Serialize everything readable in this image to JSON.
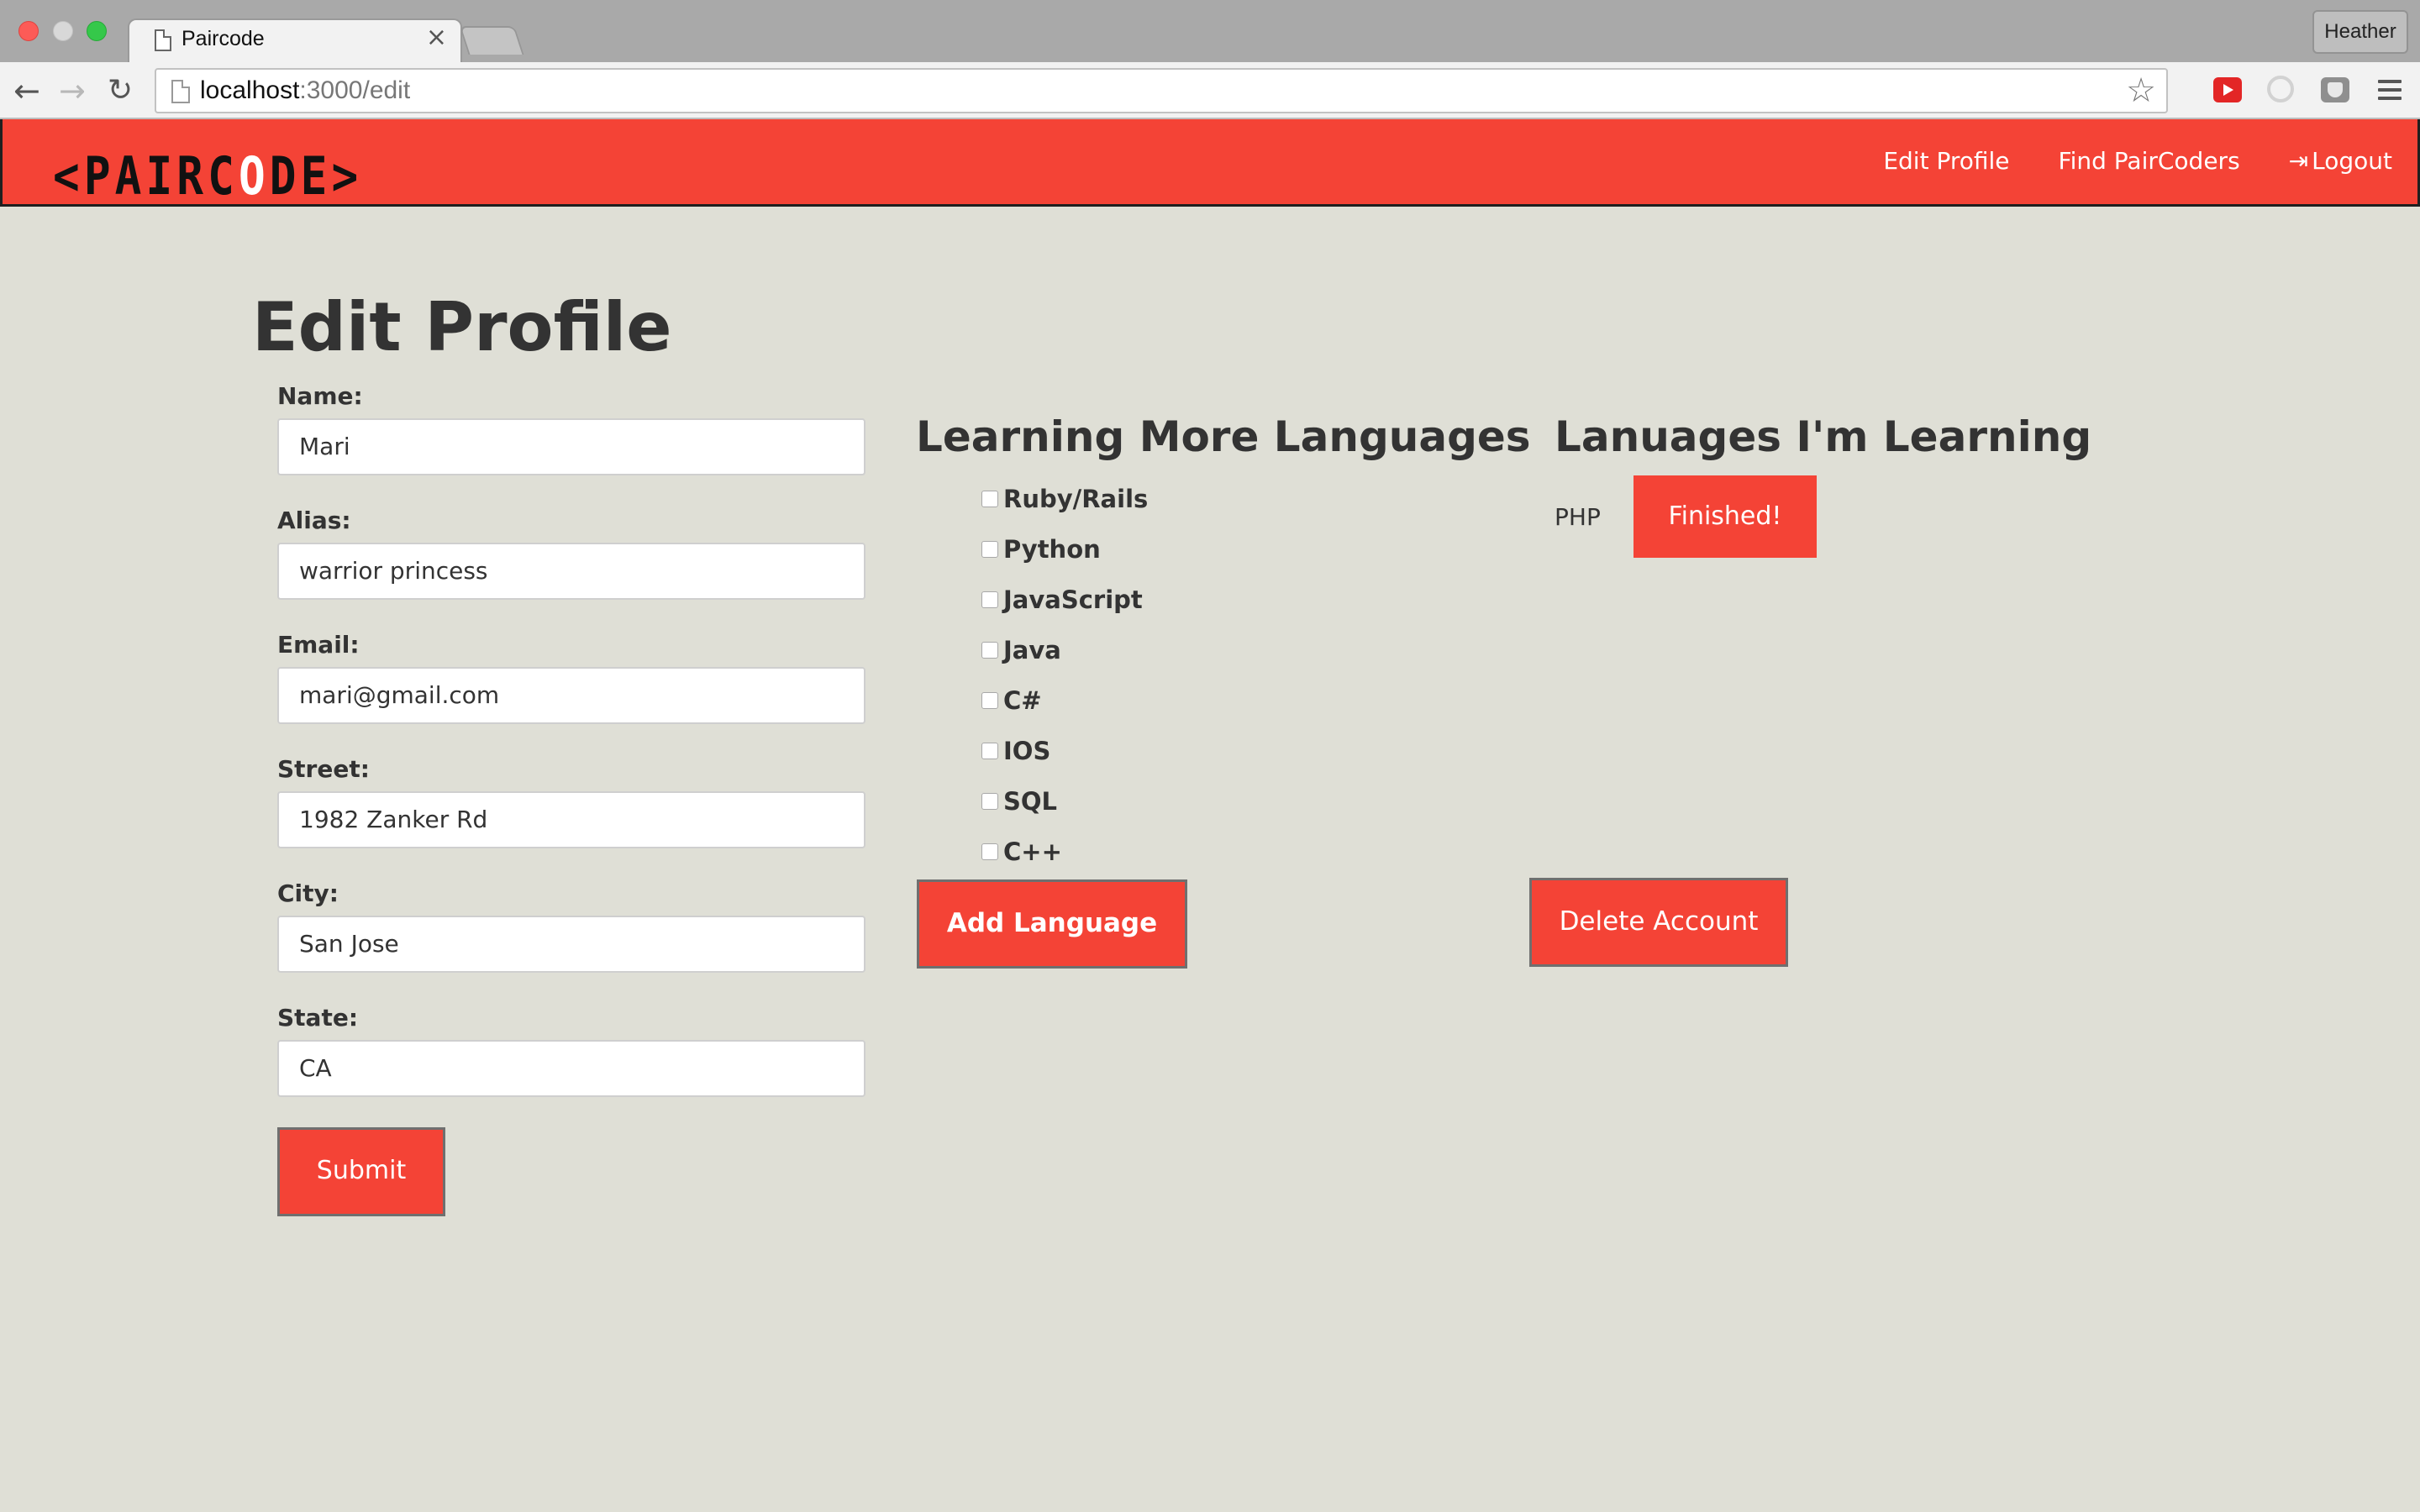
{
  "browser": {
    "tab_title": "Paircode",
    "tab_close": "×",
    "profile_name": "Heather",
    "url_host": "localhost",
    "url_path": ":3000/edit",
    "icons": {
      "back": "←",
      "forward": "→",
      "reload": "↻",
      "bookmark": "☆"
    }
  },
  "site_nav": {
    "logo_left": "<PAIRC",
    "logo_pin": "O",
    "logo_right": "DE>",
    "links": {
      "edit_profile": "Edit Profile",
      "find_paircoders": "Find PairCoders",
      "logout": "Logout",
      "logout_icon": "⇥"
    }
  },
  "page": {
    "title": "Edit Profile"
  },
  "form": {
    "fields": [
      {
        "label": "Name:",
        "value": "Mari"
      },
      {
        "label": "Alias:",
        "value": "warrior princess"
      },
      {
        "label": "Email:",
        "value": "mari@gmail.com"
      },
      {
        "label": "Street:",
        "value": "1982 Zanker Rd"
      },
      {
        "label": "City:",
        "value": "San Jose"
      },
      {
        "label": "State:",
        "value": "CA"
      }
    ],
    "submit_label": "Submit"
  },
  "learn_more": {
    "heading": "Learning More Languages",
    "languages": [
      {
        "name": "Ruby/Rails",
        "checked": false
      },
      {
        "name": "Python",
        "checked": false
      },
      {
        "name": "JavaScript",
        "checked": false
      },
      {
        "name": "Java",
        "checked": false
      },
      {
        "name": "C#",
        "checked": false
      },
      {
        "name": "IOS",
        "checked": false
      },
      {
        "name": "SQL",
        "checked": false
      },
      {
        "name": "C++",
        "checked": false
      }
    ],
    "add_button": "Add Language"
  },
  "learning": {
    "heading": "Lanuages I'm Learning",
    "items": [
      {
        "name": "PHP",
        "button": "Finished!"
      }
    ],
    "delete_button": "Delete Account"
  },
  "colors": {
    "accent": "#f44336",
    "background": "#dfdfd6",
    "text": "#333333"
  }
}
